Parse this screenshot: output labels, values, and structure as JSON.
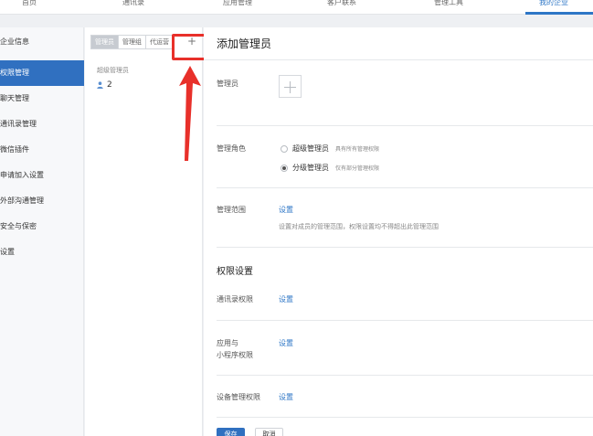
{
  "topnav": {
    "items": [
      "首页",
      "通讯录",
      "应用管理",
      "客户联系",
      "管理工具",
      "我的企业"
    ],
    "active_index": 5,
    "accent": "#2d76c6"
  },
  "sidebar": {
    "items": [
      "企业信息",
      "权限管理",
      "聊天管理",
      "通讯录管理",
      "微信插件",
      "申请加入设置",
      "外部沟通管理",
      "安全与保密",
      "设置"
    ],
    "active_index": 1
  },
  "middle": {
    "tabs": [
      "管理员",
      "管理组",
      "代运营"
    ],
    "add_label": "+",
    "group_label": "超级管理员",
    "user_count": "2"
  },
  "main": {
    "title": "添加管理员",
    "admin_label": "管理员",
    "role_label": "管理角色",
    "roles": [
      {
        "label": "超级管理员",
        "desc": "具有所有管理权限",
        "checked": false
      },
      {
        "label": "分级管理员",
        "desc": "仅有部分管理权限",
        "checked": true
      }
    ],
    "scope_label": "管理范围",
    "scope_link": "设置",
    "scope_hint": "设置对成员的管理范围，权限设置均不得超出此管理范围",
    "perm_title": "权限设置",
    "contacts_perm_label": "通讯录权限",
    "contacts_perm_link": "设置",
    "app_perm_label_line1": "应用与",
    "app_perm_label_line2": "小程序权限",
    "app_perm_link": "设置",
    "device_perm_label": "设备管理权限",
    "device_perm_link": "设置",
    "save_label": "保存",
    "cancel_label": "取消"
  },
  "annotation": {
    "highlight_color": "#e8302a"
  }
}
